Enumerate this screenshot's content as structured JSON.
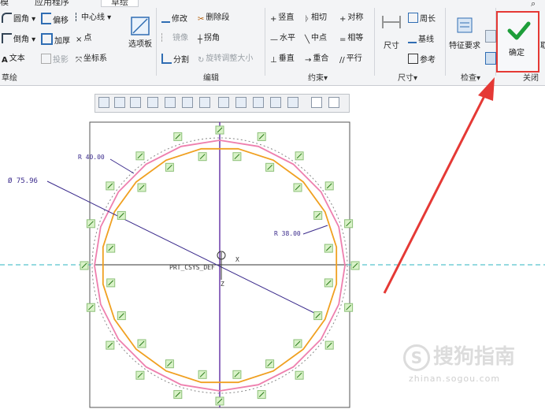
{
  "tabs": [
    "模",
    "应用程序",
    "草绘"
  ],
  "groups": {
    "sketch": {
      "label": "草绘",
      "cmds": [
        "圆角",
        "倒角",
        "文本",
        "偏移",
        "加厚",
        "投影",
        "中心线",
        "点",
        "坐标系",
        "选项板"
      ]
    },
    "edit": {
      "label": "编辑",
      "cmds": [
        "修改",
        "删除段",
        "镜像",
        "拐角",
        "分割",
        "旋转调整大小"
      ]
    },
    "constraint": {
      "label": "约束",
      "cmds": [
        "竖直",
        "相切",
        "对称",
        "水平",
        "中点",
        "相等",
        "垂直",
        "重合",
        "平行"
      ]
    },
    "dim": {
      "label": "尺寸",
      "cmds": [
        "尺寸",
        "周长",
        "基线",
        "参考"
      ]
    },
    "inspect": {
      "label": "检查",
      "cmds": [
        "特征要求"
      ]
    },
    "close": {
      "label": "关闭",
      "cmds": [
        "确定",
        "取"
      ]
    }
  },
  "sketch_labels": {
    "r40": "R 40.00",
    "d75": "Ø 75.96",
    "r38": "R 38.00",
    "csys": "PRT_CSYS_DEF"
  },
  "watermark": {
    "main": "搜狗指南",
    "url": "zhinan.sogou.com"
  },
  "colors": {
    "accent_red": "#e53935",
    "check_green": "#1e9e3a"
  }
}
